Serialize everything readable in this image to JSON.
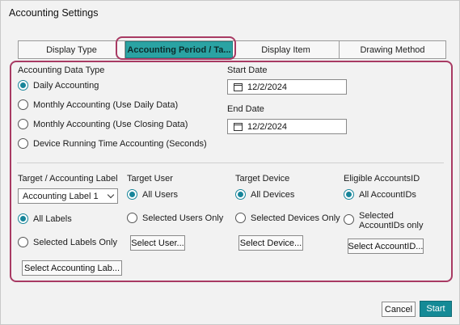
{
  "window": {
    "title": "Accounting Settings"
  },
  "tabs": [
    {
      "label": "Display Type",
      "active": false
    },
    {
      "label": "Accounting Period / Ta...",
      "active": true
    },
    {
      "label": "Display Item",
      "active": false
    },
    {
      "label": "Drawing Method",
      "active": false
    }
  ],
  "accounting_data_type": {
    "label": "Accounting Data Type",
    "options": [
      {
        "label": "Daily Accounting",
        "selected": true
      },
      {
        "label": "Monthly Accounting (Use Daily Data)",
        "selected": false
      },
      {
        "label": "Monthly Accounting (Use Closing Data)",
        "selected": false
      },
      {
        "label": "Device Running Time Accounting (Seconds)",
        "selected": false
      }
    ]
  },
  "dates": {
    "start_label": "Start Date",
    "start_value": "12/2/2024",
    "end_label": "End Date",
    "end_value": "12/2/2024"
  },
  "target_label": {
    "label": "Target / Accounting Label",
    "select_value": "Accounting Label 1",
    "all_label": "All Labels",
    "selected_label": "Selected Labels Only",
    "button": "Select Accounting Lab..."
  },
  "target_user": {
    "label": "Target User",
    "all_label": "All Users",
    "selected_label": "Selected Users Only",
    "button": "Select User..."
  },
  "target_device": {
    "label": "Target Device",
    "all_label": "All Devices",
    "selected_label": "Selected Devices Only",
    "button": "Select Device..."
  },
  "eligible_accounts": {
    "label": "Eligible AccountsID",
    "all_label": "All AccountIDs",
    "selected_label": "Selected AccountIDs only",
    "button": "Select AccountID..."
  },
  "footer": {
    "cancel": "Cancel",
    "start": "Start"
  },
  "colors": {
    "accent": "#158a96",
    "highlight": "#a83a63",
    "active_tab": "#2aa3a3"
  }
}
